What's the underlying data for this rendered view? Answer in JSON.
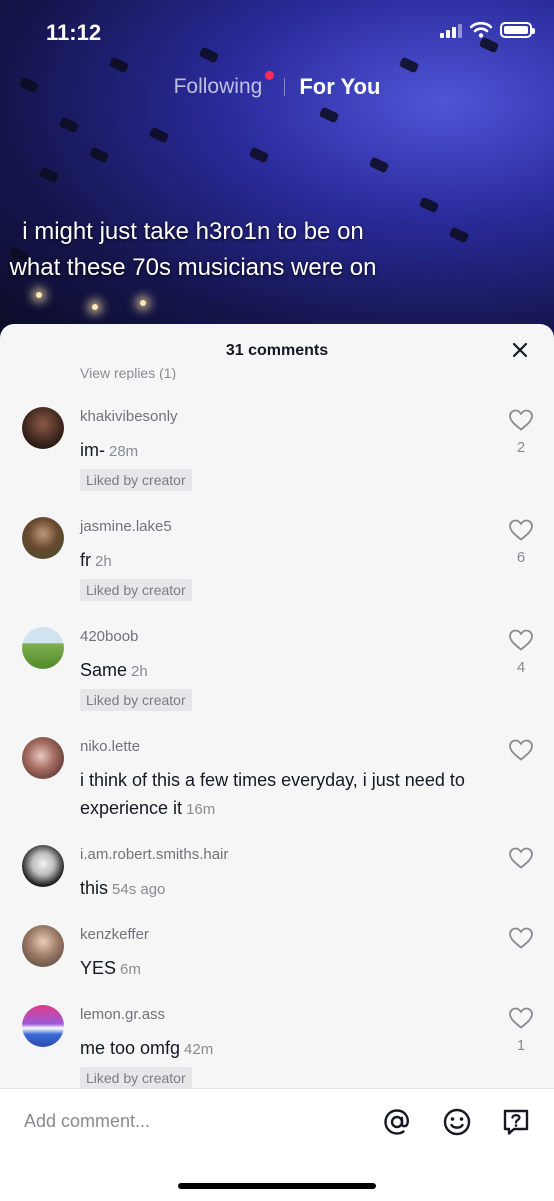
{
  "status_bar": {
    "time": "11:12"
  },
  "feed_tabs": {
    "following": "Following",
    "for_you": "For You"
  },
  "video": {
    "caption": "i might just take h3ro1n to be on what these 70s musicians were on"
  },
  "comments_sheet": {
    "title": "31 comments",
    "partial_text": "View replies (1)",
    "comments": [
      {
        "username": "khakivibesonly",
        "text": "im-",
        "time": "28m",
        "liked_by_creator": "Liked by creator",
        "likes": "2"
      },
      {
        "username": "jasmine.lake5",
        "text": "fr",
        "time": "2h",
        "liked_by_creator": "Liked by creator",
        "likes": "6"
      },
      {
        "username": "420boob",
        "text": "Same",
        "time": "2h",
        "liked_by_creator": "Liked by creator",
        "likes": "4"
      },
      {
        "username": "niko.lette",
        "text": "i think of this a few times everyday, i just need to experience it",
        "time": "16m",
        "likes": ""
      },
      {
        "username": "i.am.robert.smiths.hair",
        "text": "this",
        "time": "54s ago",
        "likes": ""
      },
      {
        "username": "kenzkeffer",
        "text": "YES",
        "time": "6m",
        "likes": ""
      },
      {
        "username": "lemon.gr.ass",
        "text": "me too omfg",
        "time": "42m",
        "liked_by_creator": "Liked by creator",
        "likes": "1"
      }
    ]
  },
  "comment_bar": {
    "placeholder": "Add comment...",
    "icons": [
      "at-icon",
      "emoji-icon",
      "question-icon"
    ]
  },
  "colors": {
    "accent_dot": "#fe2c55",
    "sheet_bg": "#f6f6f7",
    "text": "#161823",
    "muted": "#8a8b91"
  }
}
